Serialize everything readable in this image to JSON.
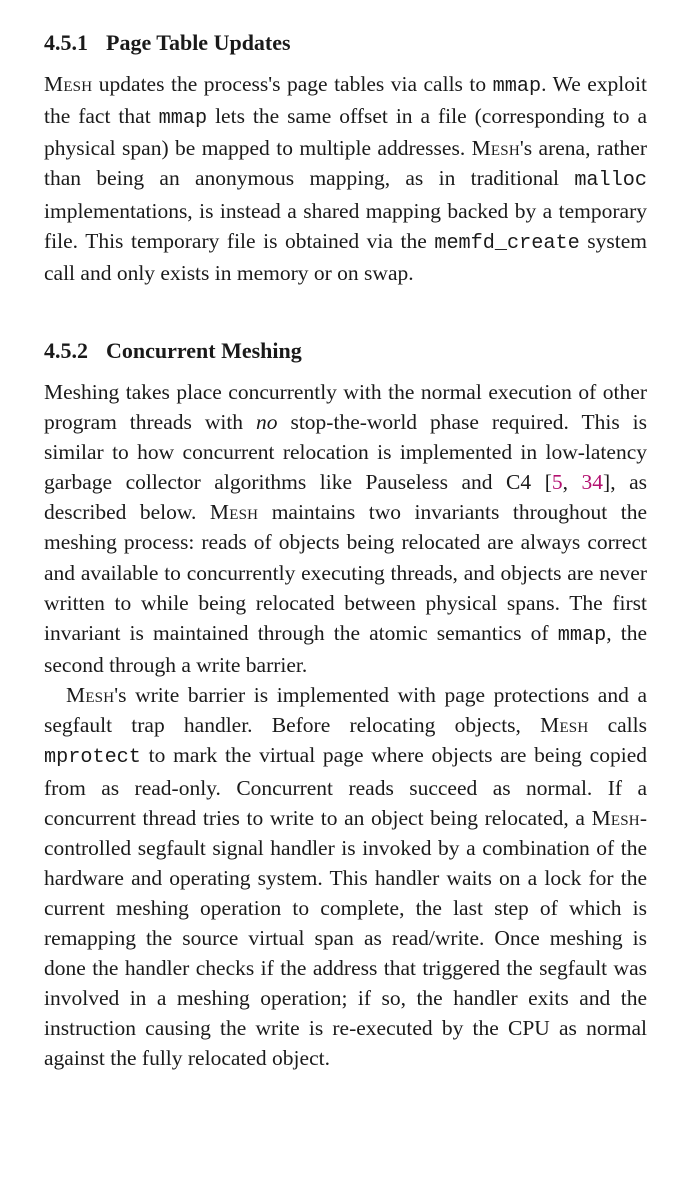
{
  "s1": {
    "num": "4.5.1",
    "title": "Page Table Updates",
    "p1a": "Mesh",
    "p1b": " updates the process's page tables via calls to ",
    "p1c": "mmap",
    "p1d": ". We exploit the fact that ",
    "p1e": "mmap",
    "p1f": " lets the same offset in a file (corresponding to a physical span) be mapped to multiple addresses. ",
    "p1g": "Mesh",
    "p1h": "'s arena, rather than being an anonymous mapping, as in traditional ",
    "p1i": "malloc",
    "p1j": " implementations, is instead a shared mapping backed by a temporary file. This temporary file is obtained via the ",
    "p1k": "memfd_create",
    "p1l": " system call and only exists in memory or on swap."
  },
  "s2": {
    "num": "4.5.2",
    "title": "Concurrent Meshing",
    "p1a": "Meshing takes place concurrently with the normal execution of other program threads with ",
    "p1b": "no",
    "p1c": " stop-the-world phase required. This is similar to how concurrent relocation is implemented in low-latency garbage collector algorithms like Pauseless and C4 ",
    "p1d_open": "[",
    "p1d_c1": "5",
    "p1d_sep": ", ",
    "p1d_c2": "34",
    "p1d_close": "]",
    "p1e": ", as described below. ",
    "p1f": "Mesh",
    "p1g": " maintains two invariants throughout the meshing process: reads of objects being relocated are always correct and available to concurrently executing threads, and objects are never written to while being relocated between physical spans. The first invariant is maintained through the atomic semantics of ",
    "p1h": "mmap",
    "p1i": ", the second through a write barrier.",
    "p2a": "Mesh",
    "p2b": "'s write barrier is implemented with page protections and a segfault trap handler. Before relocating objects, ",
    "p2c": "Mesh",
    "p2d": " calls ",
    "p2e": "mprotect",
    "p2f": " to mark the virtual page where objects are being copied from as read-only. Concurrent reads succeed as normal. If a concurrent thread tries to write to an object being relocated, a ",
    "p2g": "Mesh",
    "p2h": "-controlled segfault signal handler is invoked by a combination of the hardware and operating system. This handler waits on a lock for the current meshing operation to complete, the last step of which is remapping the source virtual span as read/write. Once meshing is done the handler checks if the address that triggered the segfault was involved in a meshing operation; if so, the handler exits and the instruction causing the write is re-executed by the CPU as normal against the fully relocated object."
  }
}
